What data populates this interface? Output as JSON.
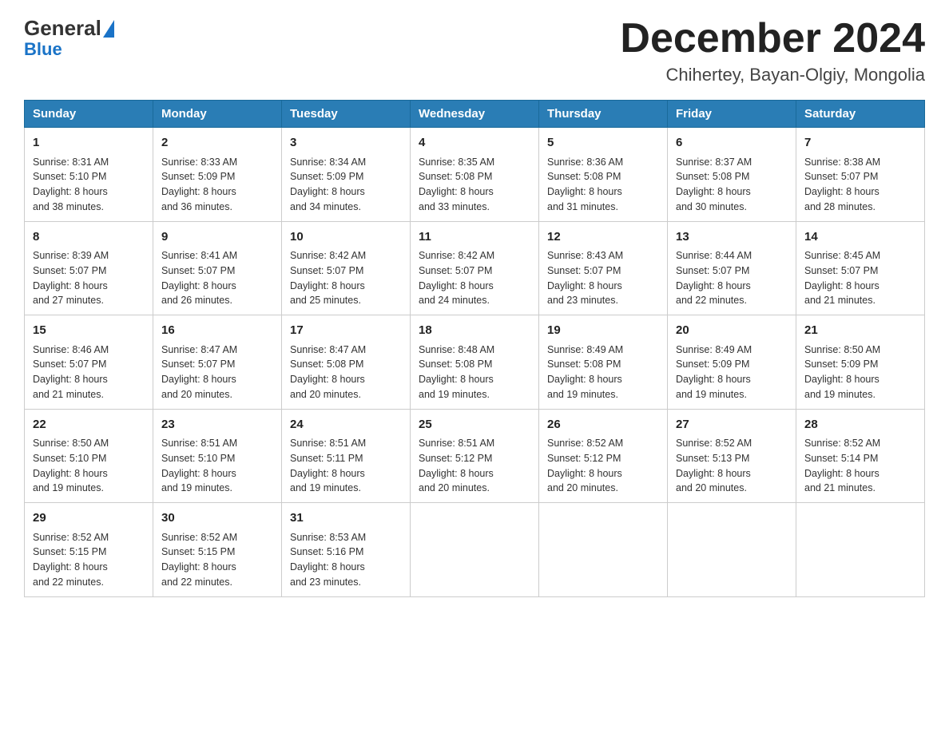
{
  "logo": {
    "text1": "General",
    "text2": "Blue"
  },
  "title": {
    "month_year": "December 2024",
    "location": "Chihertey, Bayan-Olgiy, Mongolia"
  },
  "days_of_week": [
    "Sunday",
    "Monday",
    "Tuesday",
    "Wednesday",
    "Thursday",
    "Friday",
    "Saturday"
  ],
  "weeks": [
    [
      {
        "day": "1",
        "sunrise": "8:31 AM",
        "sunset": "5:10 PM",
        "daylight": "8 hours and 38 minutes."
      },
      {
        "day": "2",
        "sunrise": "8:33 AM",
        "sunset": "5:09 PM",
        "daylight": "8 hours and 36 minutes."
      },
      {
        "day": "3",
        "sunrise": "8:34 AM",
        "sunset": "5:09 PM",
        "daylight": "8 hours and 34 minutes."
      },
      {
        "day": "4",
        "sunrise": "8:35 AM",
        "sunset": "5:08 PM",
        "daylight": "8 hours and 33 minutes."
      },
      {
        "day": "5",
        "sunrise": "8:36 AM",
        "sunset": "5:08 PM",
        "daylight": "8 hours and 31 minutes."
      },
      {
        "day": "6",
        "sunrise": "8:37 AM",
        "sunset": "5:08 PM",
        "daylight": "8 hours and 30 minutes."
      },
      {
        "day": "7",
        "sunrise": "8:38 AM",
        "sunset": "5:07 PM",
        "daylight": "8 hours and 28 minutes."
      }
    ],
    [
      {
        "day": "8",
        "sunrise": "8:39 AM",
        "sunset": "5:07 PM",
        "daylight": "8 hours and 27 minutes."
      },
      {
        "day": "9",
        "sunrise": "8:41 AM",
        "sunset": "5:07 PM",
        "daylight": "8 hours and 26 minutes."
      },
      {
        "day": "10",
        "sunrise": "8:42 AM",
        "sunset": "5:07 PM",
        "daylight": "8 hours and 25 minutes."
      },
      {
        "day": "11",
        "sunrise": "8:42 AM",
        "sunset": "5:07 PM",
        "daylight": "8 hours and 24 minutes."
      },
      {
        "day": "12",
        "sunrise": "8:43 AM",
        "sunset": "5:07 PM",
        "daylight": "8 hours and 23 minutes."
      },
      {
        "day": "13",
        "sunrise": "8:44 AM",
        "sunset": "5:07 PM",
        "daylight": "8 hours and 22 minutes."
      },
      {
        "day": "14",
        "sunrise": "8:45 AM",
        "sunset": "5:07 PM",
        "daylight": "8 hours and 21 minutes."
      }
    ],
    [
      {
        "day": "15",
        "sunrise": "8:46 AM",
        "sunset": "5:07 PM",
        "daylight": "8 hours and 21 minutes."
      },
      {
        "day": "16",
        "sunrise": "8:47 AM",
        "sunset": "5:07 PM",
        "daylight": "8 hours and 20 minutes."
      },
      {
        "day": "17",
        "sunrise": "8:47 AM",
        "sunset": "5:08 PM",
        "daylight": "8 hours and 20 minutes."
      },
      {
        "day": "18",
        "sunrise": "8:48 AM",
        "sunset": "5:08 PM",
        "daylight": "8 hours and 19 minutes."
      },
      {
        "day": "19",
        "sunrise": "8:49 AM",
        "sunset": "5:08 PM",
        "daylight": "8 hours and 19 minutes."
      },
      {
        "day": "20",
        "sunrise": "8:49 AM",
        "sunset": "5:09 PM",
        "daylight": "8 hours and 19 minutes."
      },
      {
        "day": "21",
        "sunrise": "8:50 AM",
        "sunset": "5:09 PM",
        "daylight": "8 hours and 19 minutes."
      }
    ],
    [
      {
        "day": "22",
        "sunrise": "8:50 AM",
        "sunset": "5:10 PM",
        "daylight": "8 hours and 19 minutes."
      },
      {
        "day": "23",
        "sunrise": "8:51 AM",
        "sunset": "5:10 PM",
        "daylight": "8 hours and 19 minutes."
      },
      {
        "day": "24",
        "sunrise": "8:51 AM",
        "sunset": "5:11 PM",
        "daylight": "8 hours and 19 minutes."
      },
      {
        "day": "25",
        "sunrise": "8:51 AM",
        "sunset": "5:12 PM",
        "daylight": "8 hours and 20 minutes."
      },
      {
        "day": "26",
        "sunrise": "8:52 AM",
        "sunset": "5:12 PM",
        "daylight": "8 hours and 20 minutes."
      },
      {
        "day": "27",
        "sunrise": "8:52 AM",
        "sunset": "5:13 PM",
        "daylight": "8 hours and 20 minutes."
      },
      {
        "day": "28",
        "sunrise": "8:52 AM",
        "sunset": "5:14 PM",
        "daylight": "8 hours and 21 minutes."
      }
    ],
    [
      {
        "day": "29",
        "sunrise": "8:52 AM",
        "sunset": "5:15 PM",
        "daylight": "8 hours and 22 minutes."
      },
      {
        "day": "30",
        "sunrise": "8:52 AM",
        "sunset": "5:15 PM",
        "daylight": "8 hours and 22 minutes."
      },
      {
        "day": "31",
        "sunrise": "8:53 AM",
        "sunset": "5:16 PM",
        "daylight": "8 hours and 23 minutes."
      },
      null,
      null,
      null,
      null
    ]
  ],
  "labels": {
    "sunrise": "Sunrise:",
    "sunset": "Sunset:",
    "daylight": "Daylight:"
  }
}
